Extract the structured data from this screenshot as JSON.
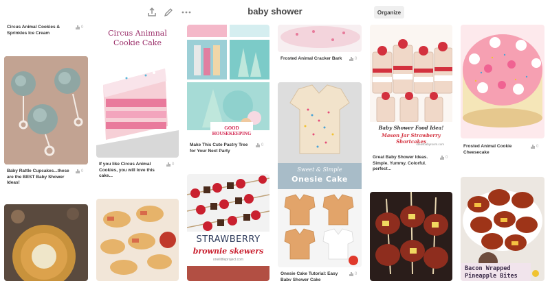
{
  "header": {
    "title": "baby shower",
    "organize_label": "Organize",
    "icons": [
      "upload-icon",
      "edit-icon",
      "more-icon"
    ]
  },
  "pins": {
    "p1": {
      "caption": "Circus Animal Cookies & Sprinkles Ice Cream",
      "count": "0"
    },
    "p2": {
      "caption": "Baby Rattle Cupcakes...these are the BEST Baby Shower Ideas!",
      "count": "0"
    },
    "p3": {
      "image_text_line1": "Circus Animnal",
      "image_text_line2": "Cookie Cake",
      "caption": "If you like Circus Animal Cookies, you will love this cake...",
      "count": "0"
    },
    "p4": {
      "image_text_line1": "GOOD",
      "image_text_line2": "HOUSEKEEPING",
      "caption": "Make This Cute Pastry Tree for Your Next Party",
      "count": "0"
    },
    "p5": {
      "image_text_line1": "STRAWBERRY",
      "image_text_line2": "brownie skewers",
      "image_text_line3": "oneilittleproject.com"
    },
    "p6": {
      "caption": "Frosted Animal Cracker Bark",
      "count": "0"
    },
    "p7": {
      "image_text_line1": "Sweet & Simple",
      "image_text_line2": "Onesie Cake",
      "caption": "Onesie Cake Tutorial: Easy Baby Shower Cake",
      "count": "0"
    },
    "p8": {
      "image_text_line1": "Baby Shower Food Idea!",
      "image_text_line2": "Mason Jar Strawberry Shortcakes",
      "image_text_line3": "ideasbabyroom.com",
      "caption": "Great Baby Shower Ideas. Simple. Yummy. Colorful. perfect...",
      "count": "0"
    },
    "p9": {
      "caption": "Frosted Animal Cookie Cheesecake",
      "count": "0"
    },
    "p10": {
      "image_text_line1": "Bacon Wrapped",
      "image_text_line2": "Pineapple Bites"
    }
  },
  "colors": {
    "accent": "#bd081c",
    "caption": "#333333",
    "muted": "#b5b5b5"
  }
}
